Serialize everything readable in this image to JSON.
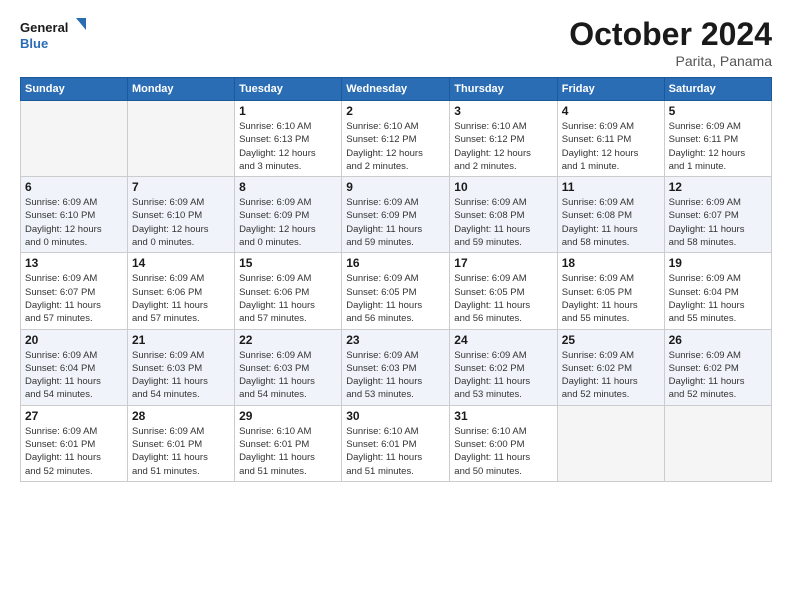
{
  "logo": {
    "line1": "General",
    "line2": "Blue"
  },
  "title": "October 2024",
  "location": "Parita, Panama",
  "weekdays": [
    "Sunday",
    "Monday",
    "Tuesday",
    "Wednesday",
    "Thursday",
    "Friday",
    "Saturday"
  ],
  "weeks": [
    [
      {
        "day": "",
        "detail": ""
      },
      {
        "day": "",
        "detail": ""
      },
      {
        "day": "1",
        "detail": "Sunrise: 6:10 AM\nSunset: 6:13 PM\nDaylight: 12 hours\nand 3 minutes."
      },
      {
        "day": "2",
        "detail": "Sunrise: 6:10 AM\nSunset: 6:12 PM\nDaylight: 12 hours\nand 2 minutes."
      },
      {
        "day": "3",
        "detail": "Sunrise: 6:10 AM\nSunset: 6:12 PM\nDaylight: 12 hours\nand 2 minutes."
      },
      {
        "day": "4",
        "detail": "Sunrise: 6:09 AM\nSunset: 6:11 PM\nDaylight: 12 hours\nand 1 minute."
      },
      {
        "day": "5",
        "detail": "Sunrise: 6:09 AM\nSunset: 6:11 PM\nDaylight: 12 hours\nand 1 minute."
      }
    ],
    [
      {
        "day": "6",
        "detail": "Sunrise: 6:09 AM\nSunset: 6:10 PM\nDaylight: 12 hours\nand 0 minutes."
      },
      {
        "day": "7",
        "detail": "Sunrise: 6:09 AM\nSunset: 6:10 PM\nDaylight: 12 hours\nand 0 minutes."
      },
      {
        "day": "8",
        "detail": "Sunrise: 6:09 AM\nSunset: 6:09 PM\nDaylight: 12 hours\nand 0 minutes."
      },
      {
        "day": "9",
        "detail": "Sunrise: 6:09 AM\nSunset: 6:09 PM\nDaylight: 11 hours\nand 59 minutes."
      },
      {
        "day": "10",
        "detail": "Sunrise: 6:09 AM\nSunset: 6:08 PM\nDaylight: 11 hours\nand 59 minutes."
      },
      {
        "day": "11",
        "detail": "Sunrise: 6:09 AM\nSunset: 6:08 PM\nDaylight: 11 hours\nand 58 minutes."
      },
      {
        "day": "12",
        "detail": "Sunrise: 6:09 AM\nSunset: 6:07 PM\nDaylight: 11 hours\nand 58 minutes."
      }
    ],
    [
      {
        "day": "13",
        "detail": "Sunrise: 6:09 AM\nSunset: 6:07 PM\nDaylight: 11 hours\nand 57 minutes."
      },
      {
        "day": "14",
        "detail": "Sunrise: 6:09 AM\nSunset: 6:06 PM\nDaylight: 11 hours\nand 57 minutes."
      },
      {
        "day": "15",
        "detail": "Sunrise: 6:09 AM\nSunset: 6:06 PM\nDaylight: 11 hours\nand 57 minutes."
      },
      {
        "day": "16",
        "detail": "Sunrise: 6:09 AM\nSunset: 6:05 PM\nDaylight: 11 hours\nand 56 minutes."
      },
      {
        "day": "17",
        "detail": "Sunrise: 6:09 AM\nSunset: 6:05 PM\nDaylight: 11 hours\nand 56 minutes."
      },
      {
        "day": "18",
        "detail": "Sunrise: 6:09 AM\nSunset: 6:05 PM\nDaylight: 11 hours\nand 55 minutes."
      },
      {
        "day": "19",
        "detail": "Sunrise: 6:09 AM\nSunset: 6:04 PM\nDaylight: 11 hours\nand 55 minutes."
      }
    ],
    [
      {
        "day": "20",
        "detail": "Sunrise: 6:09 AM\nSunset: 6:04 PM\nDaylight: 11 hours\nand 54 minutes."
      },
      {
        "day": "21",
        "detail": "Sunrise: 6:09 AM\nSunset: 6:03 PM\nDaylight: 11 hours\nand 54 minutes."
      },
      {
        "day": "22",
        "detail": "Sunrise: 6:09 AM\nSunset: 6:03 PM\nDaylight: 11 hours\nand 54 minutes."
      },
      {
        "day": "23",
        "detail": "Sunrise: 6:09 AM\nSunset: 6:03 PM\nDaylight: 11 hours\nand 53 minutes."
      },
      {
        "day": "24",
        "detail": "Sunrise: 6:09 AM\nSunset: 6:02 PM\nDaylight: 11 hours\nand 53 minutes."
      },
      {
        "day": "25",
        "detail": "Sunrise: 6:09 AM\nSunset: 6:02 PM\nDaylight: 11 hours\nand 52 minutes."
      },
      {
        "day": "26",
        "detail": "Sunrise: 6:09 AM\nSunset: 6:02 PM\nDaylight: 11 hours\nand 52 minutes."
      }
    ],
    [
      {
        "day": "27",
        "detail": "Sunrise: 6:09 AM\nSunset: 6:01 PM\nDaylight: 11 hours\nand 52 minutes."
      },
      {
        "day": "28",
        "detail": "Sunrise: 6:09 AM\nSunset: 6:01 PM\nDaylight: 11 hours\nand 51 minutes."
      },
      {
        "day": "29",
        "detail": "Sunrise: 6:10 AM\nSunset: 6:01 PM\nDaylight: 11 hours\nand 51 minutes."
      },
      {
        "day": "30",
        "detail": "Sunrise: 6:10 AM\nSunset: 6:01 PM\nDaylight: 11 hours\nand 51 minutes."
      },
      {
        "day": "31",
        "detail": "Sunrise: 6:10 AM\nSunset: 6:00 PM\nDaylight: 11 hours\nand 50 minutes."
      },
      {
        "day": "",
        "detail": ""
      },
      {
        "day": "",
        "detail": ""
      }
    ]
  ]
}
